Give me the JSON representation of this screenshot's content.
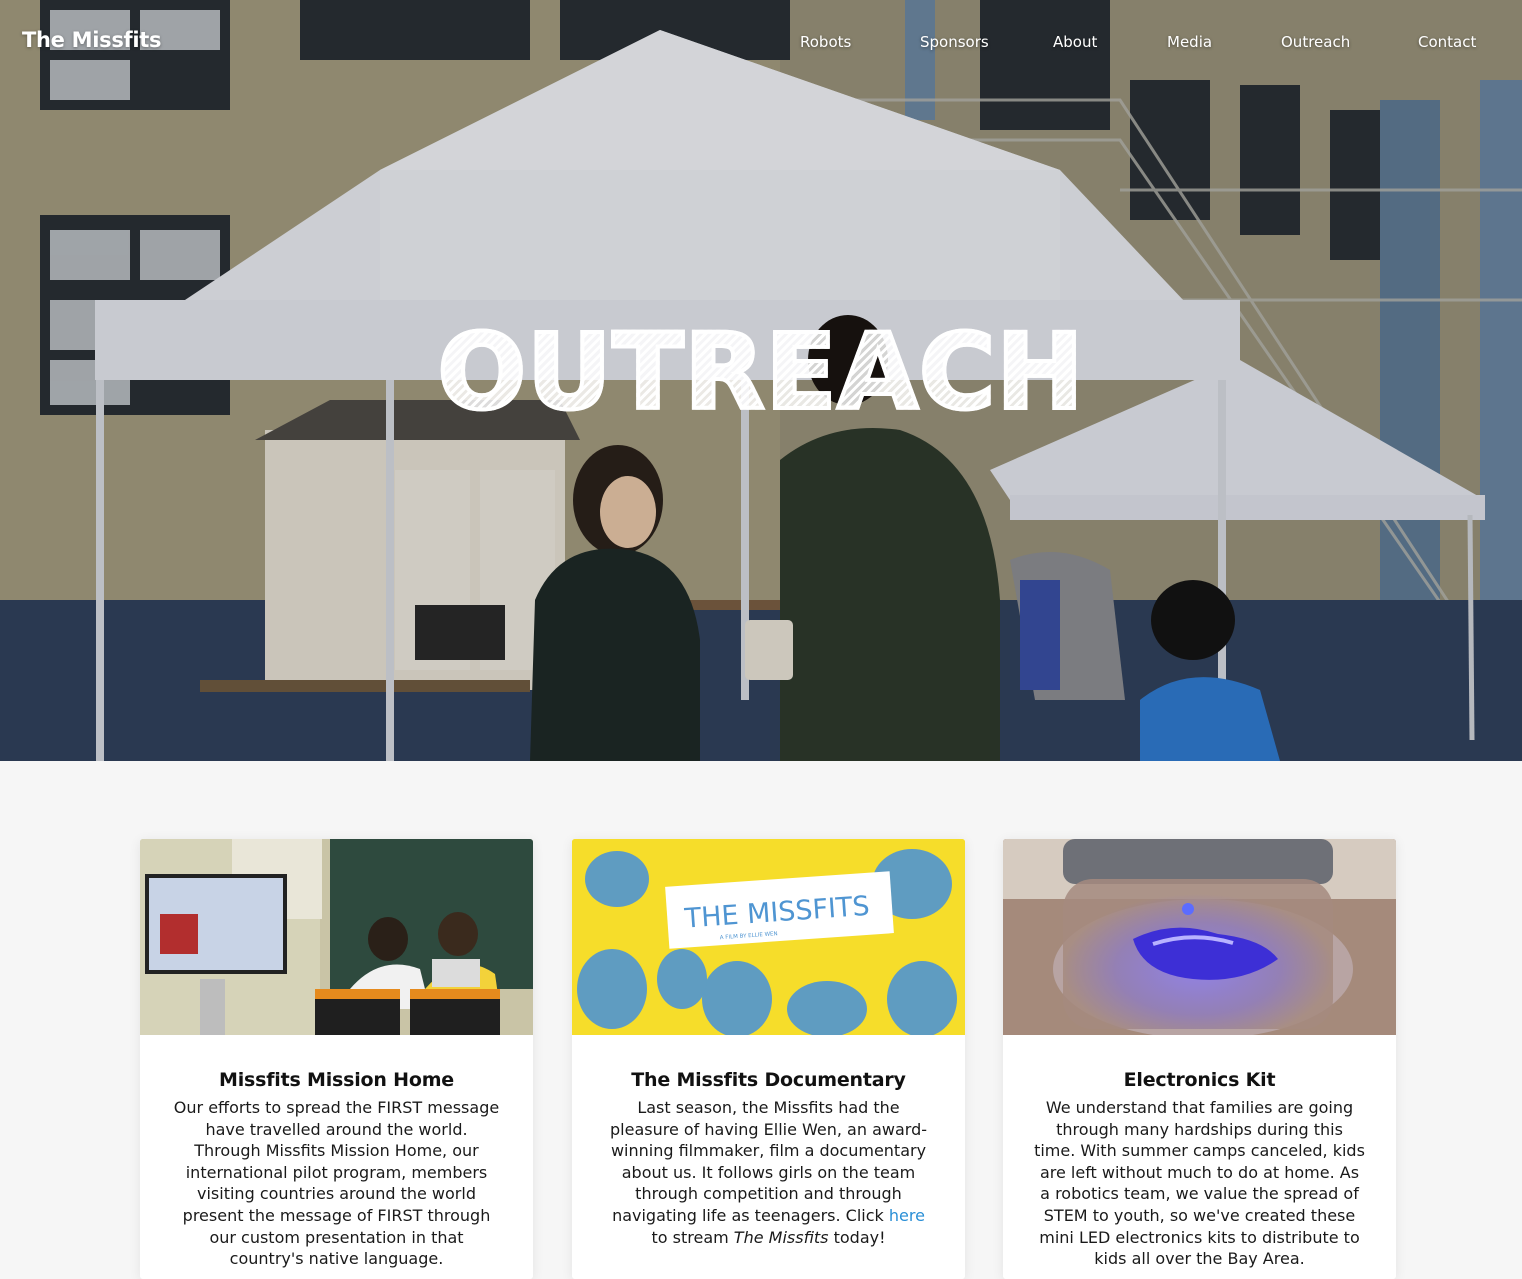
{
  "brand": "The Missfits",
  "nav": {
    "items": [
      "Robots",
      "Sponsors",
      "About",
      "Media",
      "Outreach",
      "Contact"
    ]
  },
  "hero": {
    "title": "OUTREACH"
  },
  "cards": [
    {
      "title": "Missfits Mission Home",
      "body": "Our efforts to spread the FIRST message have travelled around the world. Through Missfits Mission Home, our international pilot program, members visiting countries around the world present the message of FIRST through our custom presentation in that country's native language."
    },
    {
      "title": "The Missfits Documentary",
      "body_before_link": "Last season, the Missfits had the pleasure of having Ellie Wen, an award-winning filmmaker, film a documentary about us. It follows girls on the team through competition and through navigating life as teenagers. Click ",
      "link_label": "here",
      "body_mid": " to stream ",
      "body_italic": "The Missfits",
      "body_after": " today!",
      "poster": {
        "title": "THE MISSFITS",
        "subtitle": "A FILM BY ELLIE WEN"
      }
    },
    {
      "title": "Electronics Kit",
      "body": "We understand that families are going through many hardships during this time. With summer camps canceled, kids are left without much to do at home. As a robotics team, we value the spread of STEM to youth, so we've created these mini LED electronics kits to distribute to kids all over the Bay Area."
    }
  ],
  "colors": {
    "link": "#2a8fd6",
    "page_bg": "#f6f6f6",
    "poster_yellow": "#f6dd2a",
    "poster_blue": "#4f95d2"
  }
}
